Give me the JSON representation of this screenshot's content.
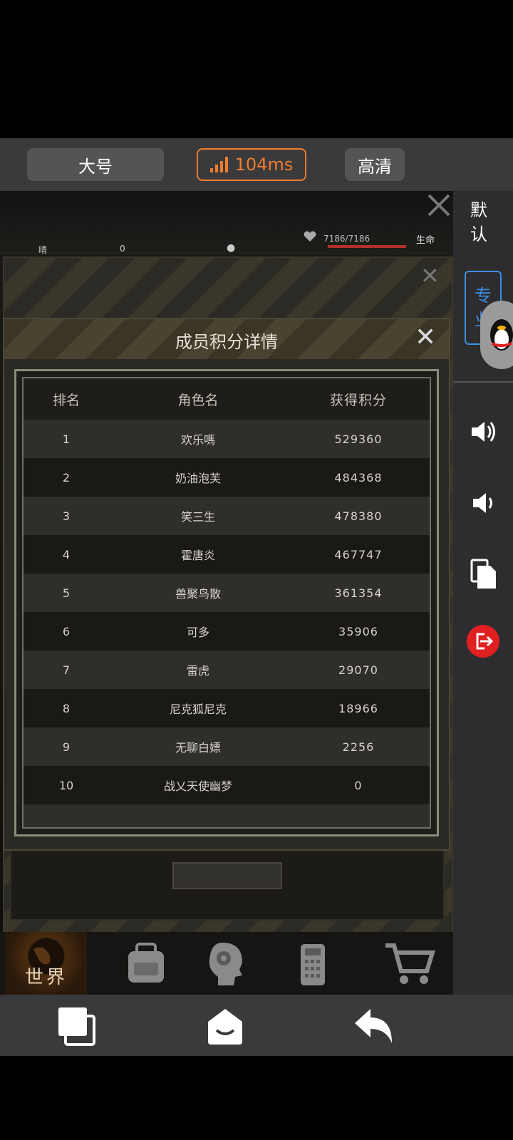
{
  "topbar": {
    "size_label": "大号",
    "ping_label": "104ms",
    "quality_label": "高清"
  },
  "hud": {
    "weather": "晴",
    "radiation": "0",
    "hp_text": "7186/7186",
    "life_label": "生命"
  },
  "dialog": {
    "title": "成员积分详情",
    "columns": [
      "排名",
      "角色名",
      "获得积分"
    ],
    "rows": [
      {
        "rank": "1",
        "name": "欢乐嗎",
        "score": "529360"
      },
      {
        "rank": "2",
        "name": "奶油泡芙",
        "score": "484368"
      },
      {
        "rank": "3",
        "name": "笑三生",
        "score": "478380"
      },
      {
        "rank": "4",
        "name": "霍唐炎",
        "score": "467747"
      },
      {
        "rank": "5",
        "name": "兽聚鸟散",
        "score": "361354"
      },
      {
        "rank": "6",
        "name": "可多",
        "score": "35906"
      },
      {
        "rank": "7",
        "name": "雷虎",
        "score": "29070"
      },
      {
        "rank": "8",
        "name": "尼克狐尼克",
        "score": "18966"
      },
      {
        "rank": "9",
        "name": "无聊白嫖",
        "score": "2256"
      },
      {
        "rank": "10",
        "name": "战乂天使幽梦",
        "score": "0"
      }
    ]
  },
  "gamenav": {
    "world_label": "世界"
  },
  "sidepanel": {
    "mode_default": "默认",
    "mode_pro": "专业"
  },
  "colors": {
    "accent_orange": "#f07c2e",
    "pro_blue": "#3b8ee6",
    "exit_red": "#e02020"
  },
  "icons": [
    "signal-icon",
    "heart-icon",
    "close-icon",
    "backpack-icon",
    "head-gear-icon",
    "radio-icon",
    "cart-icon",
    "qq-penguin-icon",
    "volume-up-icon",
    "volume-down-icon",
    "copy-icon",
    "exit-icon",
    "multitask-icon",
    "home-icon",
    "back-icon"
  ]
}
